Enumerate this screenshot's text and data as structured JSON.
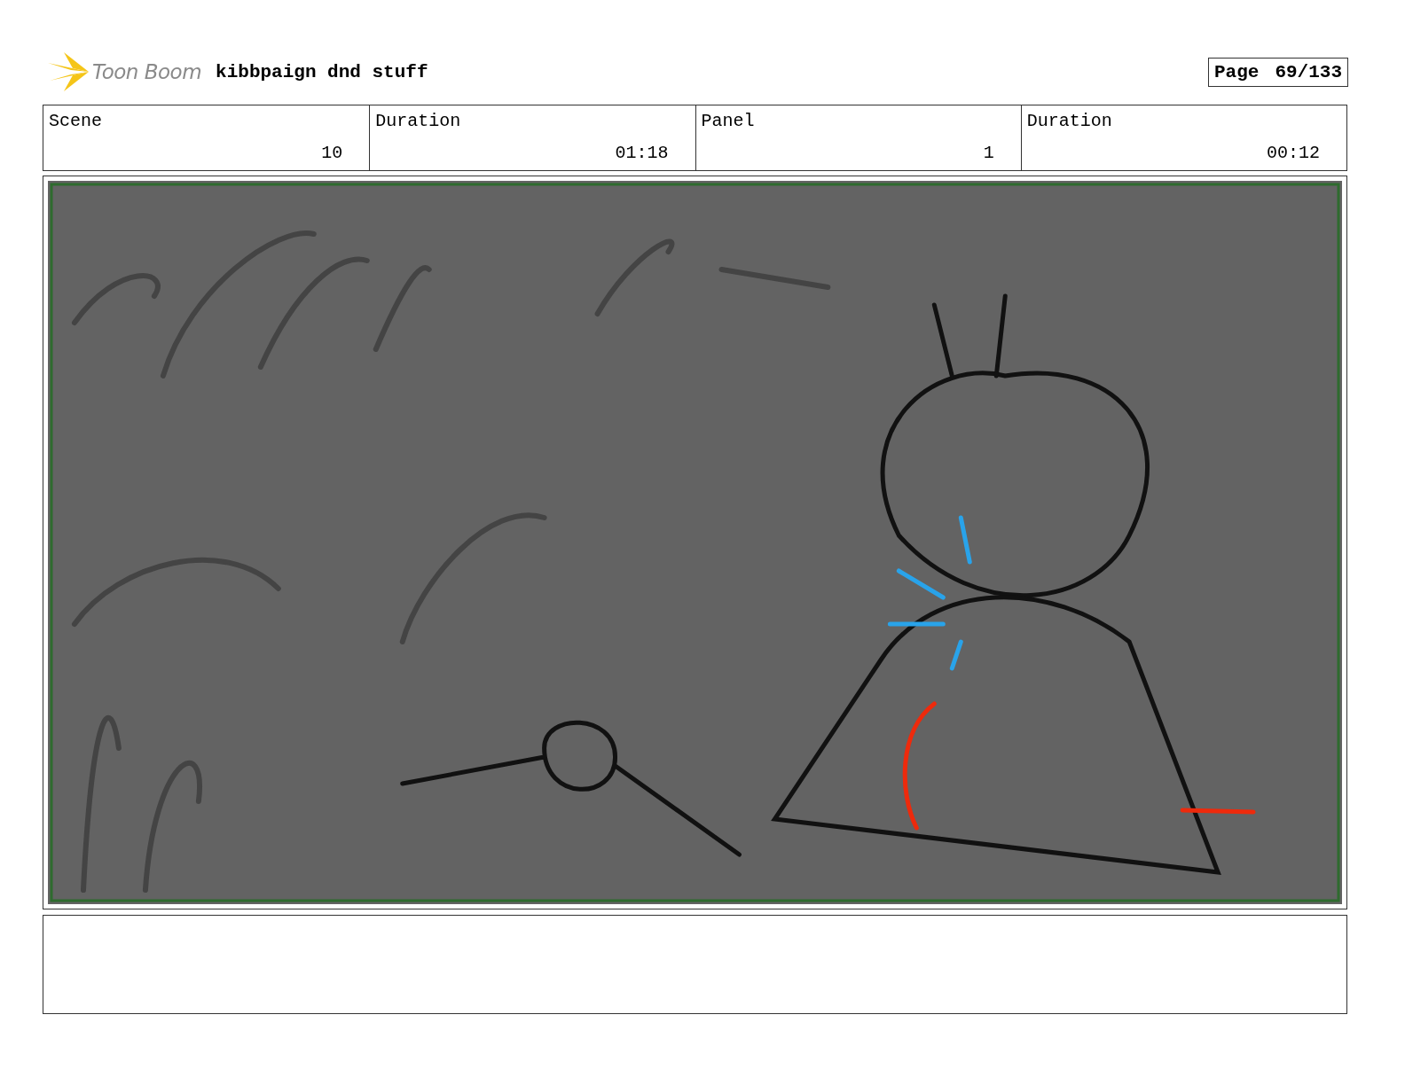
{
  "header": {
    "logo": "Toon Boom",
    "title": "kibbpaign dnd stuff",
    "page_label": "Page",
    "page_number": "69/133"
  },
  "info": [
    {
      "label": "Scene",
      "value": "10"
    },
    {
      "label": "Duration",
      "value": "01:18"
    },
    {
      "label": "Panel",
      "value": "1"
    },
    {
      "label": "Duration",
      "value": "00:12"
    }
  ]
}
